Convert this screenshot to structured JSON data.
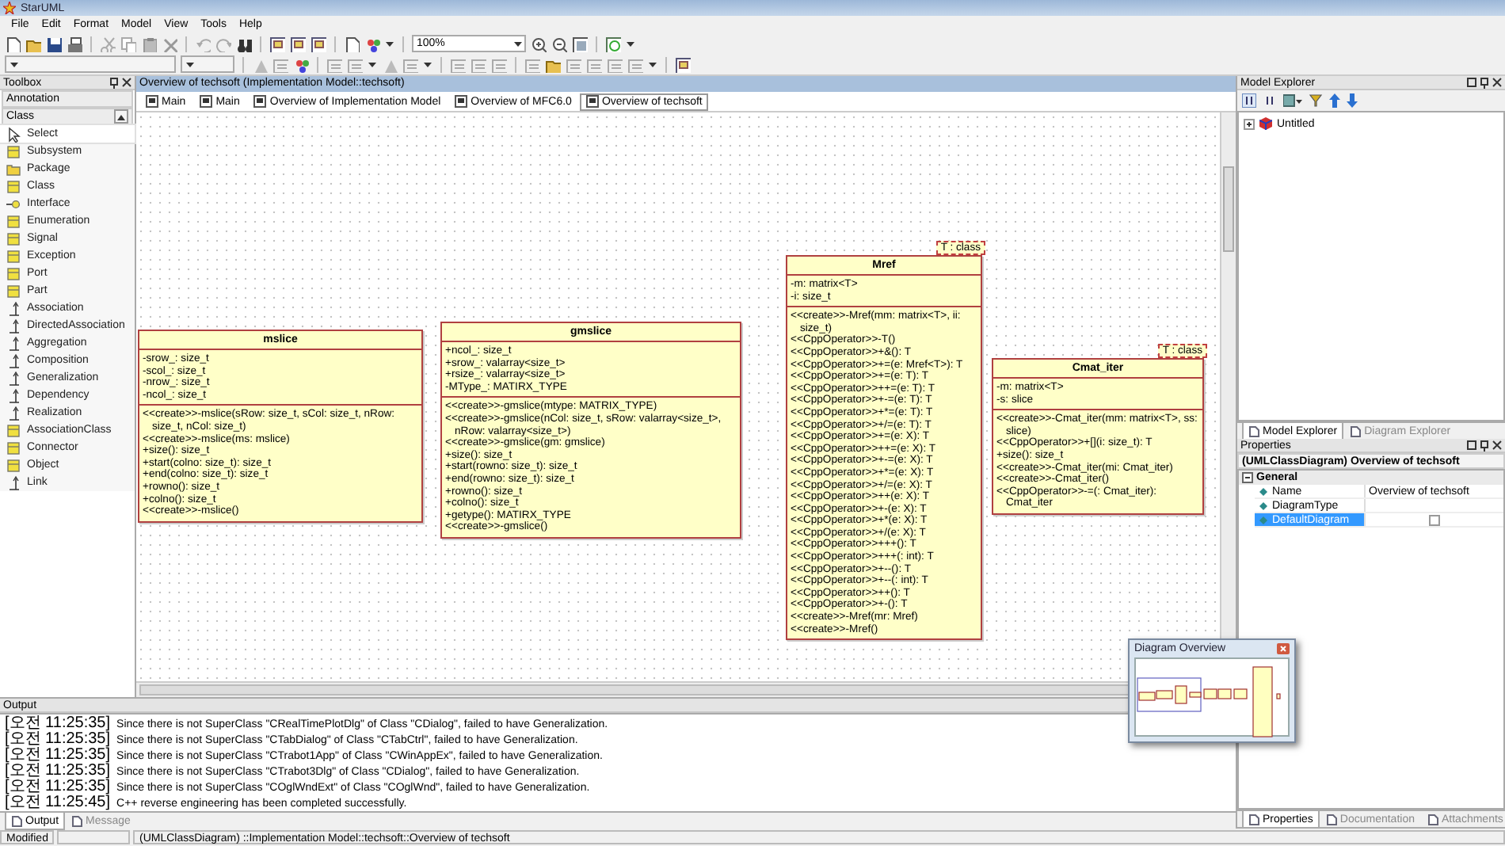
{
  "window": {
    "title": "StarUML"
  },
  "menu": [
    "File",
    "Edit",
    "Format",
    "Model",
    "View",
    "Tools",
    "Help"
  ],
  "toolbar": {
    "zoom": "100%"
  },
  "toolbox": {
    "title": "Toolbox",
    "sections": [
      {
        "label": "Annotation",
        "expanded": false
      },
      {
        "label": "Class",
        "expanded": true
      }
    ],
    "items": [
      {
        "label": "Select",
        "kind": "pointer",
        "selected": true
      },
      {
        "label": "Subsystem",
        "kind": "element",
        "selected": false
      },
      {
        "label": "Package",
        "kind": "folder",
        "selected": false
      },
      {
        "label": "Class",
        "kind": "element",
        "selected": false
      },
      {
        "label": "Interface",
        "kind": "interface",
        "selected": false
      },
      {
        "label": "Enumeration",
        "kind": "element",
        "selected": false
      },
      {
        "label": "Signal",
        "kind": "element",
        "selected": false
      },
      {
        "label": "Exception",
        "kind": "element",
        "selected": false
      },
      {
        "label": "Port",
        "kind": "element",
        "selected": false
      },
      {
        "label": "Part",
        "kind": "element",
        "selected": false
      },
      {
        "label": "Association",
        "kind": "relation",
        "selected": false
      },
      {
        "label": "DirectedAssociation",
        "kind": "relation",
        "selected": false
      },
      {
        "label": "Aggregation",
        "kind": "relation",
        "selected": false
      },
      {
        "label": "Composition",
        "kind": "relation",
        "selected": false
      },
      {
        "label": "Generalization",
        "kind": "relation",
        "selected": false
      },
      {
        "label": "Dependency",
        "kind": "relation",
        "selected": false
      },
      {
        "label": "Realization",
        "kind": "relation",
        "selected": false
      },
      {
        "label": "AssociationClass",
        "kind": "element",
        "selected": false
      },
      {
        "label": "Connector",
        "kind": "element",
        "selected": false
      },
      {
        "label": "Object",
        "kind": "element",
        "selected": false
      },
      {
        "label": "Link",
        "kind": "relation",
        "selected": false
      }
    ]
  },
  "diagram": {
    "title": "Overview of techsoft (Implementation Model::techsoft)",
    "tabs": [
      {
        "label": "Main",
        "selected": false
      },
      {
        "label": "Main",
        "selected": false
      },
      {
        "label": "Overview of Implementation Model",
        "selected": false
      },
      {
        "label": "Overview of MFC6.0",
        "selected": false
      },
      {
        "label": "Overview of techsoft",
        "selected": true
      }
    ],
    "classes": [
      {
        "name": "mslice",
        "attributes": [
          "-srow_: size_t",
          "-scol_: size_t",
          "-nrow_: size_t",
          "-ncol_: size_t"
        ],
        "operations": [
          "<<create>>-mslice(sRow: size_t, sCol: size_t, nRow: size_t, nCol: size_t)",
          "<<create>>-mslice(ms: mslice)",
          "+size(): size_t",
          "+start(colno: size_t): size_t",
          "+end(colno: size_t): size_t",
          "+rowno(): size_t",
          "+colno(): size_t",
          "<<create>>-mslice()"
        ]
      },
      {
        "name": "gmslice",
        "attributes": [
          "+ncol_: size_t",
          "+srow_: valarray<size_t>",
          "+rsize_: valarray<size_t>",
          "-MType_: MATIRX_TYPE"
        ],
        "operations": [
          "<<create>>-gmslice(mtype: MATRIX_TYPE)",
          "<<create>>-gmslice(nCol: size_t, sRow: valarray<size_t>, nRow: valarray<size_t>)",
          "<<create>>-gmslice(gm: gmslice)",
          "+size(): size_t",
          "+start(rowno: size_t): size_t",
          "+end(rowno: size_t): size_t",
          "+rowno(): size_t",
          "+colno(): size_t",
          "+getype(): MATIRX_TYPE",
          "<<create>>-gmslice()"
        ]
      },
      {
        "name": "Mref",
        "template": "T : class",
        "attributes": [
          "-m: matrix<T>",
          "-i: size_t"
        ],
        "operations": [
          "<<create>>-Mref(mm: matrix<T>, ii: size_t)",
          "<<CppOperator>>-T()",
          "<<CppOperator>>+&(): T",
          "<<CppOperator>>+=(e: Mref<T>): T",
          "<<CppOperator>>+=(e: T): T",
          "<<CppOperator>>++=(e: T): T",
          "<<CppOperator>>+-=(e: T): T",
          "<<CppOperator>>+*=(e: T): T",
          "<<CppOperator>>+/=(e: T): T",
          "<<CppOperator>>+=(e: X): T",
          "<<CppOperator>>++=(e: X): T",
          "<<CppOperator>>+-=(e: X): T",
          "<<CppOperator>>+*=(e: X): T",
          "<<CppOperator>>+/=(e: X): T",
          "<<CppOperator>>++(e: X): T",
          "<<CppOperator>>+-(e: X): T",
          "<<CppOperator>>+*(e: X): T",
          "<<CppOperator>>+/(e: X): T",
          "<<CppOperator>>+++(): T",
          "<<CppOperator>>+++(: int): T",
          "<<CppOperator>>+--(): T",
          "<<CppOperator>>+--(: int): T",
          "<<CppOperator>>++(): T",
          "<<CppOperator>>+-(): T",
          "<<create>>-Mref(mr: Mref)",
          "<<create>>-Mref()"
        ]
      },
      {
        "name": "Cmat_iter",
        "template": "T : class",
        "attributes": [
          "-m: matrix<T>",
          "-s: slice"
        ],
        "operations": [
          "<<create>>-Cmat_iter(mm: matrix<T>, ss: slice)",
          "<<CppOperator>>+[](i: size_t): T",
          "+size(): size_t",
          "<<create>>-Cmat_iter(mi: Cmat_iter)",
          "<<create>>-Cmat_iter()",
          "<<CppOperator>>-=(: Cmat_iter): Cmat_iter"
        ]
      }
    ]
  },
  "model_explorer": {
    "title": "Model Explorer",
    "tree": [
      {
        "label": "Untitled",
        "expanded": false
      }
    ],
    "tabs": [
      {
        "label": "Model Explorer",
        "selected": true
      },
      {
        "label": "Diagram Explorer",
        "selected": false
      }
    ]
  },
  "properties": {
    "title": "Properties",
    "heading": "(UMLClassDiagram) Overview of techsoft",
    "group": {
      "label": "General",
      "expanded": true
    },
    "rows": [
      {
        "kind": "text",
        "name": "Name",
        "value": "Overview of techsoft",
        "selected": false
      },
      {
        "kind": "text",
        "name": "DiagramType",
        "selected": false
      },
      {
        "kind": "checkbox",
        "name": "DefaultDiagram",
        "checked": false,
        "selected": true
      }
    ],
    "tabs": [
      {
        "label": "Properties",
        "selected": true
      },
      {
        "label": "Documentation",
        "selected": false
      },
      {
        "label": "Attachments",
        "selected": false
      }
    ]
  },
  "output": {
    "title": "Output",
    "lines": [
      {
        "time": "[오전 11:25:35]",
        "message": "Since there is not SuperClass \"CRealTimePlotDlg\" of Class \"CDialog\", failed to have Generalization."
      },
      {
        "time": "[오전 11:25:35]",
        "message": "Since there is not SuperClass \"CTabDialog\" of Class \"CTabCtrl\", failed to have Generalization."
      },
      {
        "time": "[오전 11:25:35]",
        "message": "Since there is not SuperClass \"CTrabot1App\" of Class \"CWinAppEx\", failed to have Generalization."
      },
      {
        "time": "[오전 11:25:35]",
        "message": "Since there is not SuperClass \"CTrabot3Dlg\" of Class \"CDialog\", failed to have Generalization."
      },
      {
        "time": "[오전 11:25:35]",
        "message": "Since there is not SuperClass \"COglWndExt\" of Class \"COglWnd\", failed to have Generalization."
      },
      {
        "time": "[오전 11:25:45]",
        "message": "C++ reverse engineering has been completed successfully."
      }
    ],
    "tabs": [
      {
        "label": "Output",
        "selected": true
      },
      {
        "label": "Message",
        "selected": false
      }
    ]
  },
  "status_bar": {
    "state": "Modified",
    "path": "(UMLClassDiagram) ::Implementation Model::techsoft::Overview of techsoft"
  },
  "overview": {
    "title": "Diagram Overview"
  }
}
